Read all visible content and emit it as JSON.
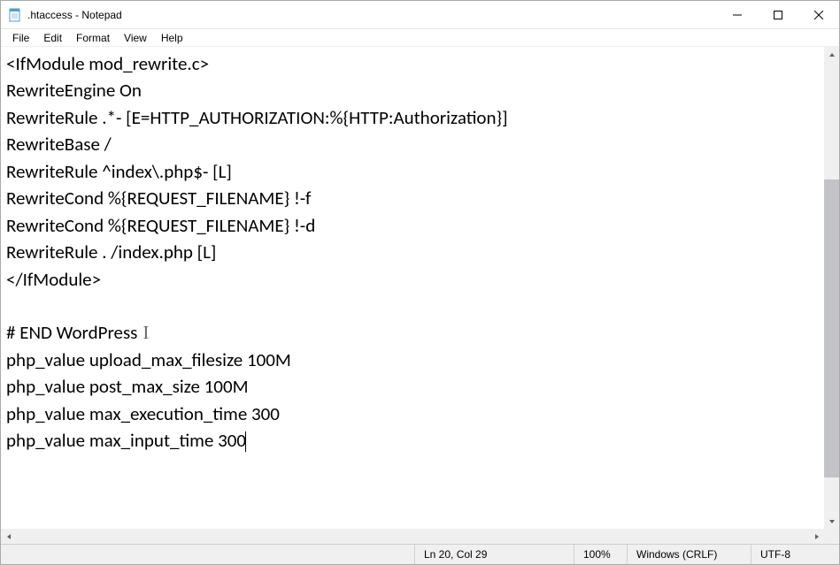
{
  "titlebar": {
    "title": ".htaccess - Notepad"
  },
  "menu": {
    "file": "File",
    "edit": "Edit",
    "format": "Format",
    "view": "View",
    "help": "Help"
  },
  "document": {
    "lines": [
      "<IfModule mod_rewrite.c>",
      "RewriteEngine On",
      "RewriteRule .*- [E=HTTP_AUTHORIZATION:%{HTTP:Authorization}]",
      "RewriteBase /",
      "RewriteRule ^index\\.php$- [L]",
      "RewriteCond %{REQUEST_FILENAME} !-f",
      "RewriteCond %{REQUEST_FILENAME} !-d",
      "RewriteRule . /index.php [L]",
      "</IfModule>",
      "",
      "# END WordPress",
      "php_value upload_max_filesize 100M",
      "php_value post_max_size 100M",
      "php_value max_execution_time 300",
      "php_value max_input_time 300"
    ]
  },
  "statusbar": {
    "position": "Ln 20, Col 29",
    "zoom": "100%",
    "line_endings": "Windows (CRLF)",
    "encoding": "UTF-8"
  }
}
